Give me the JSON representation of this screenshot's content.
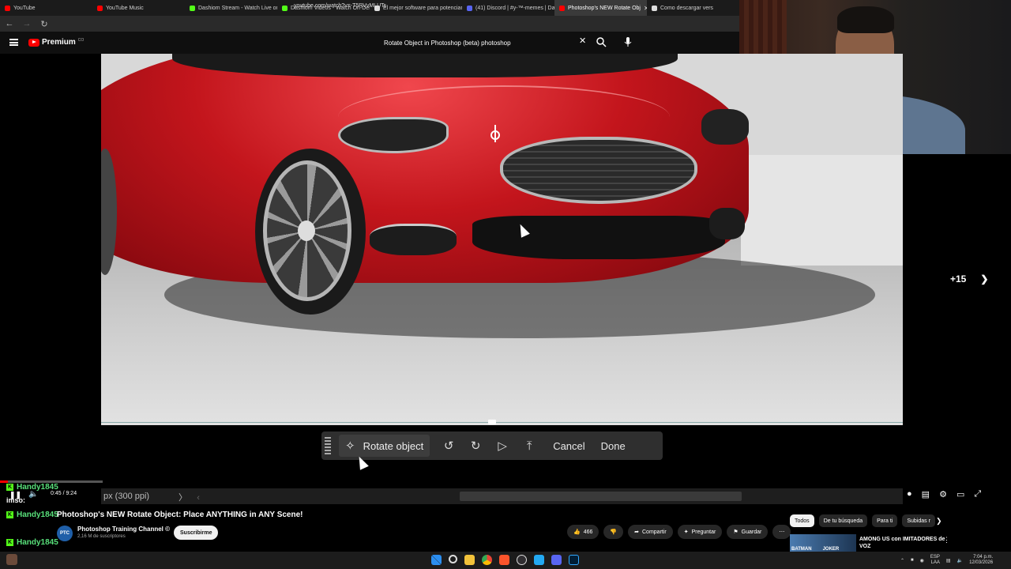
{
  "browser": {
    "tabs": [
      {
        "label": "YouTube",
        "color": "#ff0000"
      },
      {
        "label": "YouTube Music",
        "color": "#ff0000"
      },
      {
        "label": "Dashiom Stream - Watch Live on Kick",
        "color": "#53fc18"
      },
      {
        "label": "Dashiom Videos - Watch On-Deman",
        "color": "#53fc18"
      },
      {
        "label": "El mejor software para potenciar tu c",
        "color": "#dddddd"
      },
      {
        "label": "(41) Discord | #y-™-memes | Dashi",
        "color": "#5865f2"
      },
      {
        "label": "Photoshop's NEW Rotate Obj",
        "color": "#ff0000",
        "active": true
      },
      {
        "label": "Como descargar vers",
        "color": "#dddddd"
      }
    ],
    "url": "youtube.com/watch?v=-T5RVvMLUTs"
  },
  "youtube": {
    "brand": "Premium",
    "brand_sup": "CO",
    "search_query": "Rotate Object in Photoshop (beta) photoshop",
    "more_count": "+15",
    "video_title": "Photoshop's NEW Rotate Object: Place ANYTHING in ANY Scene!",
    "channel": {
      "initials": "PTC",
      "name": "Photoshop Training Channel ©",
      "subs": "2,16 M de suscriptores"
    },
    "subscribe": "Suscribirme",
    "actions": {
      "likes": "466",
      "share": "Compartir",
      "ask": "Preguntar",
      "save": "Guardar"
    },
    "chips": [
      "Todos",
      "De tu búsqueda",
      "Para ti",
      "Subidas r"
    ],
    "rec": {
      "title": "AMONG US con IMITADORES de VOZ",
      "thumb_left": "BATMAN",
      "thumb_right": "JOKER"
    },
    "time": "0:45 / 9:24",
    "progress_fraction": 0.08
  },
  "photoshop": {
    "rotate_label": "Rotate object",
    "cancel": "Cancel",
    "done": "Done",
    "status": "px (300 ppi)",
    "arrow_right": "〉",
    "arrow_left": "‹"
  },
  "chat": {
    "user": "Handy1845",
    "sub_label": "imso:"
  },
  "taskbar": {
    "lang": "ESP",
    "lang2": "LAA",
    "time": "7:04 p.m.",
    "date": "12/03/2026"
  }
}
